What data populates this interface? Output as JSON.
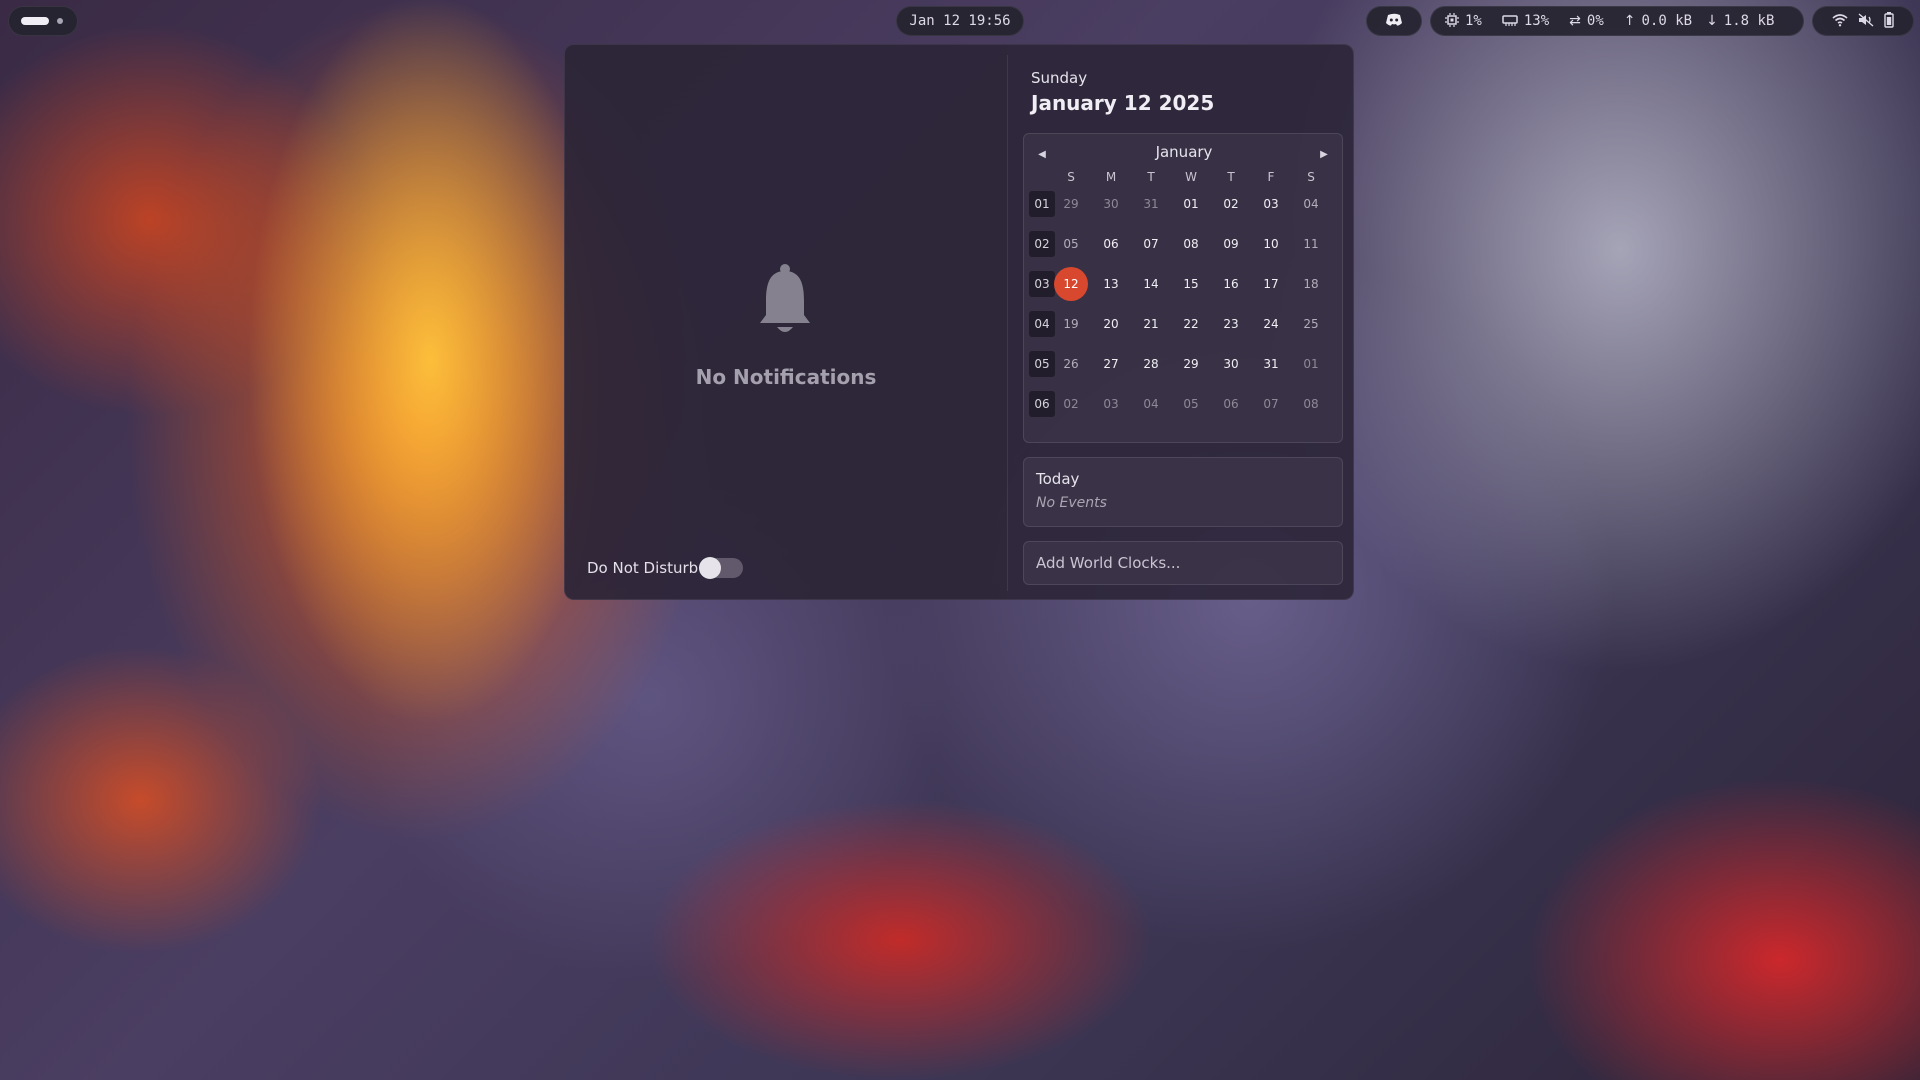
{
  "topbar": {
    "clock": "Jan 12 19:56",
    "stats": {
      "cpu": "1%",
      "memory": "13%",
      "swap": "0%",
      "upload": "0.0 kB",
      "download": "1.8 kB"
    },
    "icons": {
      "tray": "discord-icon",
      "cpu": "cpu-chip-icon",
      "memory": "memory-icon",
      "swap": "swap-arrows-icon",
      "upload": "arrow-up-icon",
      "download": "arrow-down-icon",
      "wifi": "wifi-icon",
      "volume": "volume-muted-icon",
      "battery": "battery-icon"
    }
  },
  "notifications": {
    "empty_text": "No Notifications",
    "dnd_label": "Do Not Disturb",
    "dnd_enabled": false
  },
  "calendar": {
    "day_name": "Sunday",
    "full_date": "January 12 2025",
    "month": "January",
    "weekday_headers": [
      "S",
      "M",
      "T",
      "W",
      "T",
      "F",
      "S"
    ],
    "week_numbers": [
      "01",
      "02",
      "03",
      "04",
      "05",
      "06"
    ],
    "weeks": [
      [
        "29",
        "30",
        "31",
        "01",
        "02",
        "03",
        "04"
      ],
      [
        "05",
        "06",
        "07",
        "08",
        "09",
        "10",
        "11"
      ],
      [
        "12",
        "13",
        "14",
        "15",
        "16",
        "17",
        "18"
      ],
      [
        "19",
        "20",
        "21",
        "22",
        "23",
        "24",
        "25"
      ],
      [
        "26",
        "27",
        "28",
        "29",
        "30",
        "31",
        "01"
      ],
      [
        "02",
        "03",
        "04",
        "05",
        "06",
        "07",
        "08"
      ]
    ],
    "today": "12",
    "accent": "#d8482e"
  },
  "events": {
    "title": "Today",
    "empty_text": "No Events"
  },
  "world_clocks": {
    "label": "Add World Clocks..."
  }
}
